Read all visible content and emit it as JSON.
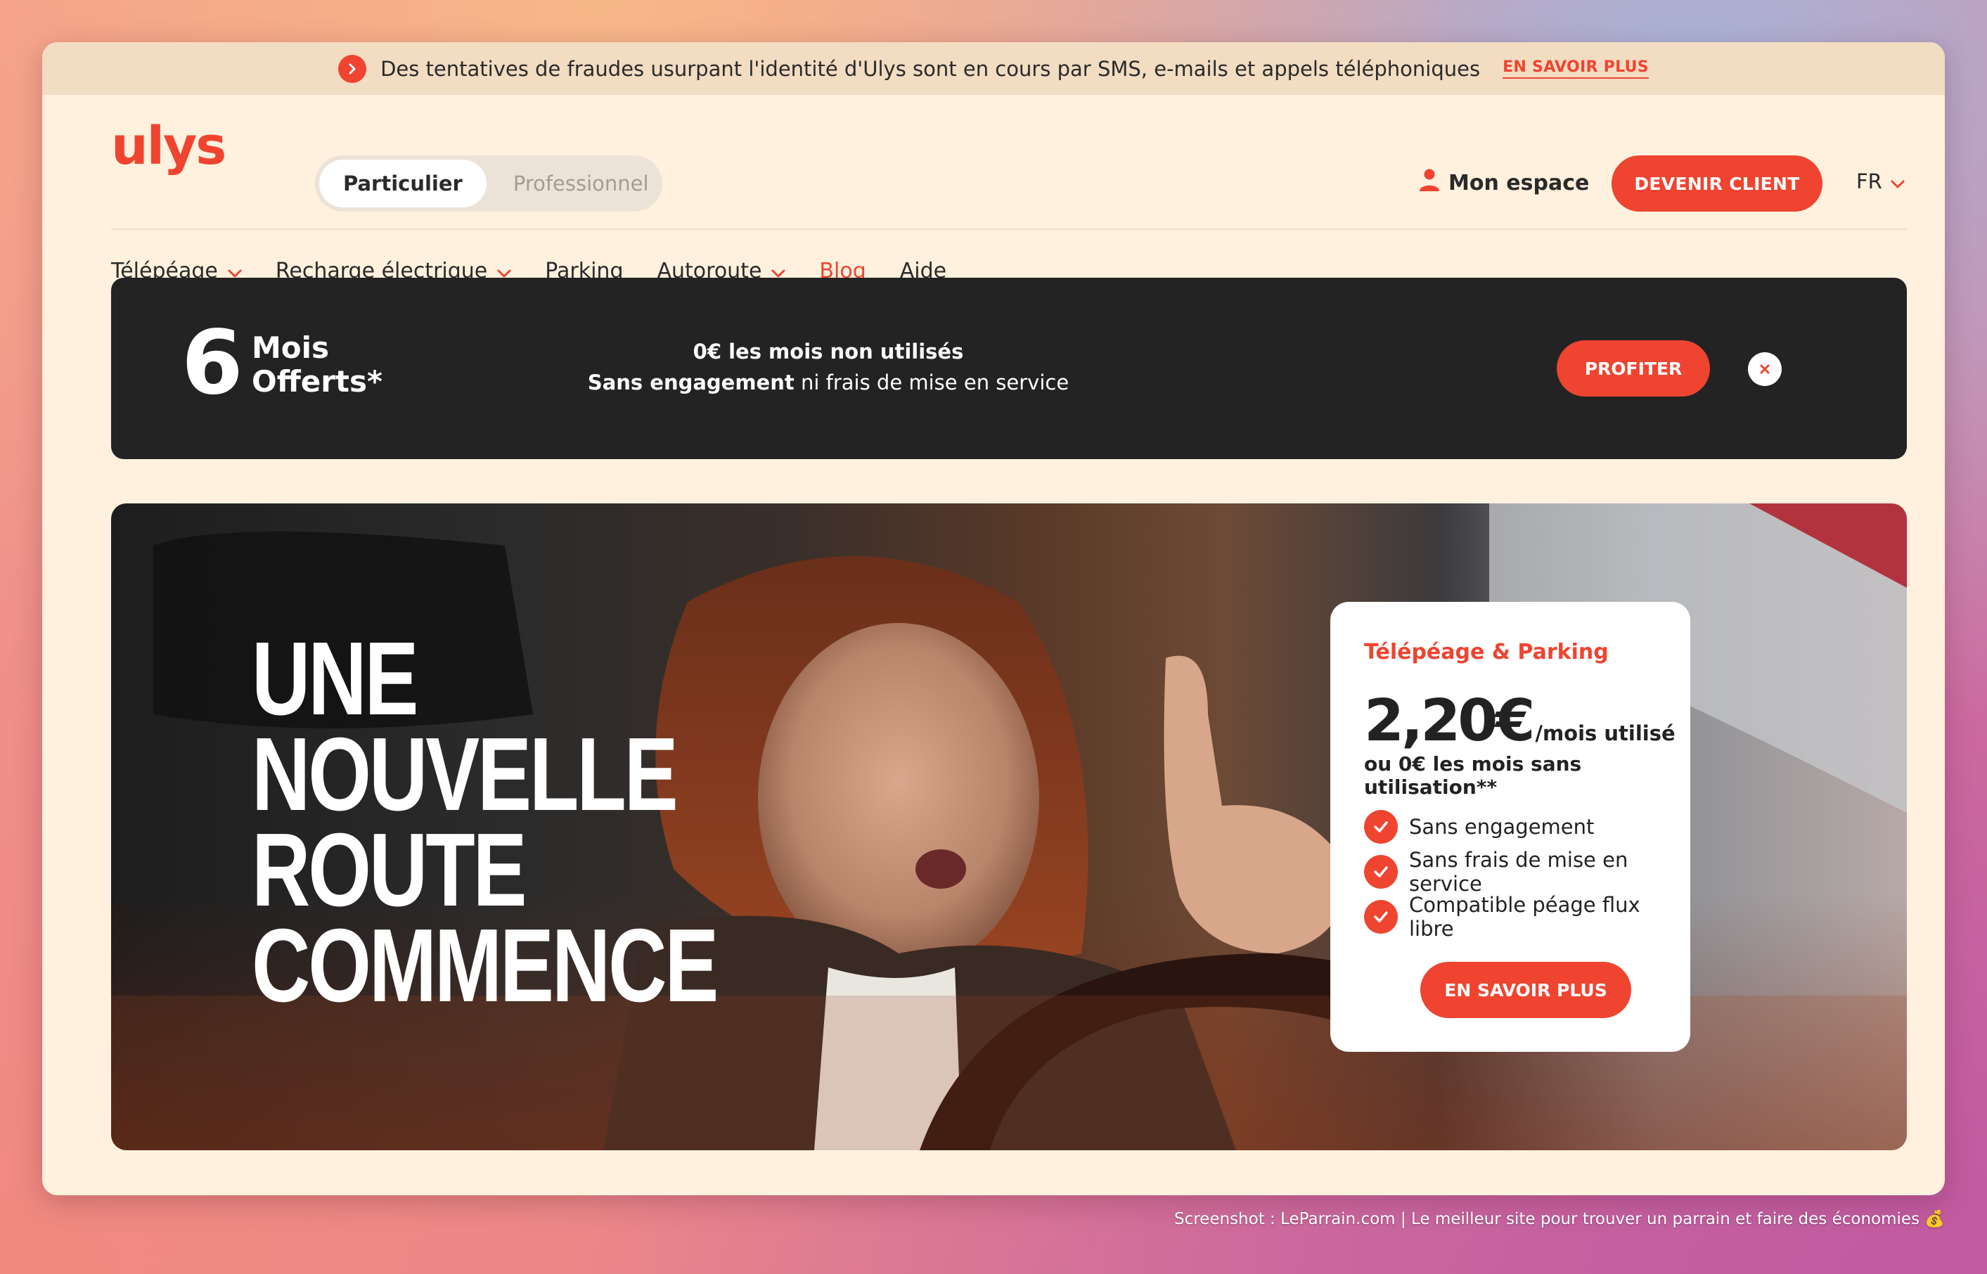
{
  "alert": {
    "text": "Des tentatives de fraudes usurpant l'identité d'Ulys sont en cours par SMS, e-mails et appels téléphoniques",
    "link": "EN SAVOIR PLUS"
  },
  "header": {
    "logo": "ulys",
    "segments": [
      "Particulier",
      "Professionnel"
    ],
    "account": "Mon espace",
    "cta": "DEVENIR CLIENT",
    "lang": "FR"
  },
  "nav": [
    {
      "label": "Télépéage",
      "dropdown": true
    },
    {
      "label": "Recharge électrique",
      "dropdown": true
    },
    {
      "label": "Parking",
      "dropdown": false
    },
    {
      "label": "Autoroute",
      "dropdown": true
    },
    {
      "label": "Blog",
      "dropdown": false
    },
    {
      "label": "Aide",
      "dropdown": false
    }
  ],
  "promo": {
    "number": "6",
    "line1": "Mois",
    "line2": "Offerts*",
    "text1": "0€ les mois non utilisés",
    "text2_strong": "Sans engagement",
    "text2_rest": " ni frais de mise en service",
    "button": "PROFITER"
  },
  "hero": {
    "title_lines": [
      "UNE",
      "NOUVELLE",
      "ROUTE",
      "COMMENCE"
    ]
  },
  "card": {
    "title": "Télépéage & Parking",
    "price": "2,20€",
    "unit": "/mois utilisé",
    "sub": "ou 0€ les mois sans utilisation**",
    "features": [
      "Sans engagement",
      "Sans frais de mise en service",
      "Compatible péage flux libre"
    ],
    "button": "EN SAVOIR PLUS"
  },
  "footer_note": "Screenshot : LeParrain.com | Le meilleur site pour trouver un parrain et faire des économies 💰",
  "colors": {
    "accent": "#ef4430",
    "background": "#fff1de",
    "promo_bg": "#232323"
  }
}
